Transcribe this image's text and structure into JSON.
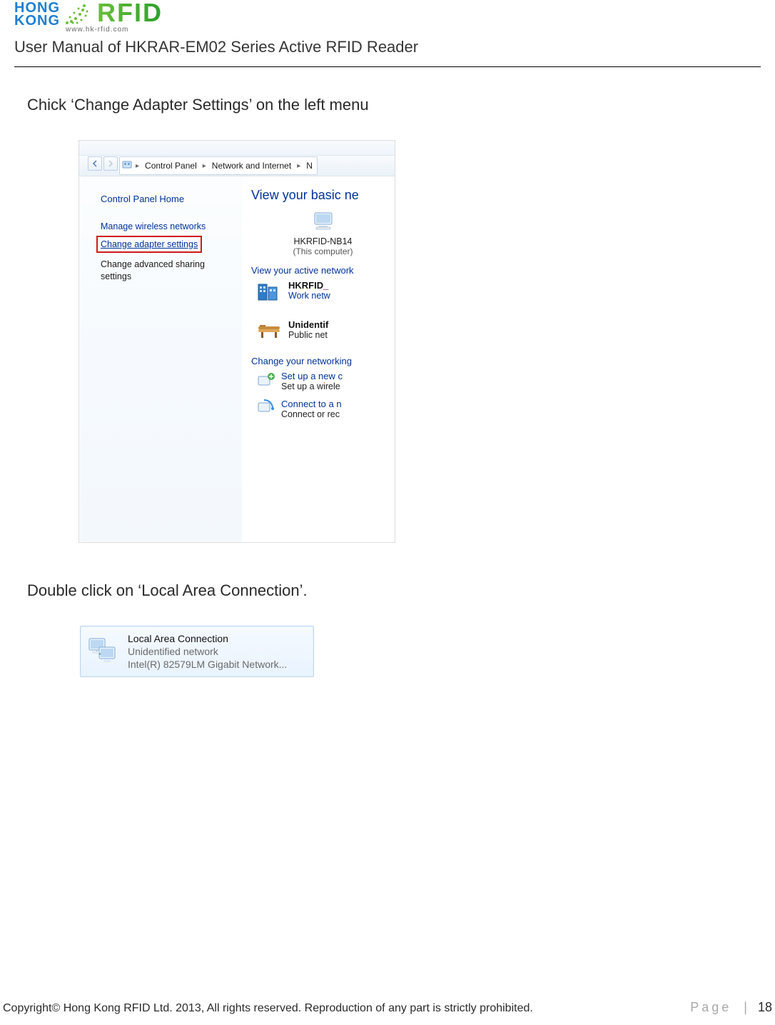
{
  "header": {
    "logo_hk_line1": "HONG",
    "logo_hk_line2": "KONG",
    "logo_rfid": "RFID",
    "logo_sub": "www.hk-rfid.com",
    "manual_title": "User Manual of HKRAR-EM02 Series Active RFID Reader"
  },
  "instruction1": "Chick ‘Change Adapter Settings’ on the left menu",
  "shot1": {
    "breadcrumb": {
      "item1": "Control Panel",
      "item2": "Network and Internet",
      "item3_partial": "N"
    },
    "left": {
      "home": "Control Panel Home",
      "link_wireless": "Manage wireless networks",
      "link_adapter": "Change adapter settings",
      "link_sharing": "Change advanced sharing settings"
    },
    "right": {
      "heading_basic": "View your basic ne",
      "computer_name": "HKRFID-NB14",
      "computer_sub": "(This computer)",
      "heading_active": "View your active network",
      "net1_title": "HKRFID_",
      "net1_sub": "Work netw",
      "net2_title": "Unidentif",
      "net2_sub": "Public net",
      "chg_head": "Change your networking",
      "opt1_title": "Set up a new c",
      "opt1_sub": "Set up a wirele",
      "opt2_title": "Connect to a n",
      "opt2_sub": "Connect or rec"
    }
  },
  "instruction2": "Double click on ‘Local Area Connection’.",
  "shot2": {
    "title": "Local Area Connection",
    "sub1": "Unidentified network",
    "sub2": "Intel(R) 82579LM Gigabit Network..."
  },
  "footer": {
    "left": "Copyright© Hong Kong RFID Ltd. 2013, All rights reserved. Reproduction of any part is strictly prohibited.",
    "right_label": "Page",
    "right_sep": "|",
    "right_num": "18"
  }
}
